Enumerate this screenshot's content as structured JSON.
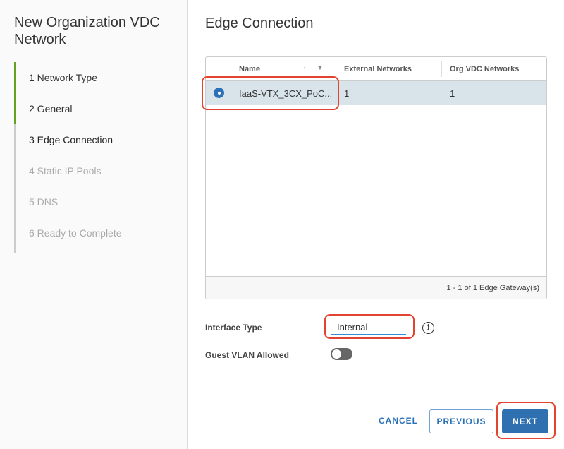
{
  "wizard": {
    "title": "New Organization VDC Network",
    "steps": [
      {
        "label": "1  Network Type",
        "state": "done"
      },
      {
        "label": "2  General",
        "state": "done"
      },
      {
        "label": "3  Edge Connection",
        "state": "current"
      },
      {
        "label": "4  Static IP Pools",
        "state": "todo"
      },
      {
        "label": "5  DNS",
        "state": "todo"
      },
      {
        "label": "6   Ready to Complete",
        "state": "todo"
      }
    ]
  },
  "main": {
    "title": "Edge Connection",
    "grid": {
      "columns": [
        "Name",
        "External Networks",
        "Org VDC Networks"
      ],
      "sort_icon": "arrow-up-icon",
      "filter_icon": "filter-icon",
      "rows": [
        {
          "name": "IaaS-VTX_3CX_PoC...",
          "external": "1",
          "org_vdc": "1",
          "selected": true
        }
      ],
      "footer": "1 - 1 of 1 Edge Gateway(s)"
    },
    "interface_type": {
      "label": "Interface Type",
      "value": "Internal",
      "info_icon": "info-icon"
    },
    "guest_vlan": {
      "label": "Guest VLAN Allowed",
      "enabled": false
    },
    "buttons": {
      "cancel": "CANCEL",
      "previous": "PREVIOUS",
      "next": "NEXT"
    }
  },
  "colors": {
    "accent": "#2f71b0",
    "done": "#62a420",
    "selected_row": "#d9e4ea",
    "highlight": "#e2442f"
  }
}
